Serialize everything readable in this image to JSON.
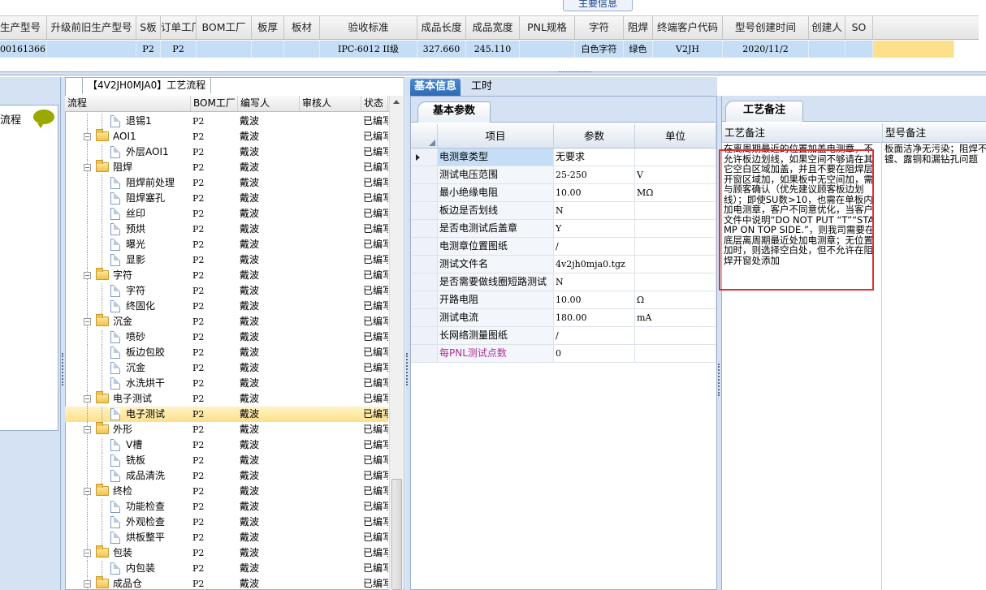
{
  "top": {
    "section_label": "主要信息",
    "columns": [
      "生产型号",
      "升级前旧生产型号",
      "S板",
      "订单工厂",
      "BOM工厂",
      "板厚",
      "板材",
      "验收标准",
      "成品长度",
      "成品宽度",
      "PNL规格",
      "字符",
      "阻焊",
      "终端客户代码",
      "型号创建时间",
      "创建人",
      "SO"
    ],
    "row": [
      "00161366",
      "",
      "P2",
      "P2",
      "",
      "",
      "",
      "IPC-6012 II级",
      "327.660",
      "245.110",
      "",
      "白色字符",
      "绿色",
      "V2JH",
      "2020/11/2",
      "",
      ""
    ]
  },
  "left": {
    "label": "流程"
  },
  "tree": {
    "tab_label": "【4V2JH0MJA0】工艺流程",
    "columns": [
      "流程",
      "BOM工厂",
      "编写人",
      "审核人",
      "状态"
    ],
    "rows": [
      {
        "name": "退锡1",
        "level": 2,
        "type": "doc",
        "bom": "P2",
        "writer": "戴波",
        "reviewer": "",
        "status": "已编写"
      },
      {
        "name": "AOI1",
        "level": 1,
        "type": "folder",
        "bom": "P2",
        "writer": "戴波",
        "reviewer": "",
        "status": "已编写"
      },
      {
        "name": "外层AOI1",
        "level": 2,
        "type": "doc",
        "bom": "P2",
        "writer": "戴波",
        "reviewer": "",
        "status": "已编写"
      },
      {
        "name": "阻焊",
        "level": 1,
        "type": "folder",
        "bom": "P2",
        "writer": "戴波",
        "reviewer": "",
        "status": "已编写"
      },
      {
        "name": "阻焊前处理",
        "level": 2,
        "type": "doc",
        "bom": "P2",
        "writer": "戴波",
        "reviewer": "",
        "status": "已编写"
      },
      {
        "name": "阻焊塞孔",
        "level": 2,
        "type": "doc",
        "bom": "P2",
        "writer": "戴波",
        "reviewer": "",
        "status": "已编写"
      },
      {
        "name": "丝印",
        "level": 2,
        "type": "doc",
        "bom": "P2",
        "writer": "戴波",
        "reviewer": "",
        "status": "已编写"
      },
      {
        "name": "预烘",
        "level": 2,
        "type": "doc",
        "bom": "P2",
        "writer": "戴波",
        "reviewer": "",
        "status": "已编写"
      },
      {
        "name": "曝光",
        "level": 2,
        "type": "doc",
        "bom": "P2",
        "writer": "戴波",
        "reviewer": "",
        "status": "已编写"
      },
      {
        "name": "显影",
        "level": 2,
        "type": "doc",
        "bom": "P2",
        "writer": "戴波",
        "reviewer": "",
        "status": "已编写"
      },
      {
        "name": "字符",
        "level": 1,
        "type": "folder",
        "bom": "P2",
        "writer": "戴波",
        "reviewer": "",
        "status": "已编写"
      },
      {
        "name": "字符",
        "level": 2,
        "type": "doc",
        "bom": "P2",
        "writer": "戴波",
        "reviewer": "",
        "status": "已编写"
      },
      {
        "name": "终固化",
        "level": 2,
        "type": "doc",
        "bom": "P2",
        "writer": "戴波",
        "reviewer": "",
        "status": "已编写"
      },
      {
        "name": "沉金",
        "level": 1,
        "type": "folder",
        "bom": "P2",
        "writer": "戴波",
        "reviewer": "",
        "status": "已编写"
      },
      {
        "name": "喷砂",
        "level": 2,
        "type": "doc",
        "bom": "P2",
        "writer": "戴波",
        "reviewer": "",
        "status": "已编写"
      },
      {
        "name": "板边包胶",
        "level": 2,
        "type": "doc",
        "bom": "P2",
        "writer": "戴波",
        "reviewer": "",
        "status": "已编写"
      },
      {
        "name": "沉金",
        "level": 2,
        "type": "doc",
        "bom": "P2",
        "writer": "戴波",
        "reviewer": "",
        "status": "已编写"
      },
      {
        "name": "水洗烘干",
        "level": 2,
        "type": "doc",
        "bom": "P2",
        "writer": "戴波",
        "reviewer": "",
        "status": "已编写"
      },
      {
        "name": "电子测试",
        "level": 1,
        "type": "folder",
        "bom": "P2",
        "writer": "戴波",
        "reviewer": "",
        "status": "已编写"
      },
      {
        "name": "电子测试",
        "level": 2,
        "type": "doc",
        "bom": "P2",
        "writer": "戴波",
        "reviewer": "",
        "status": "已编写",
        "selected": true
      },
      {
        "name": "外形",
        "level": 1,
        "type": "folder",
        "bom": "P2",
        "writer": "戴波",
        "reviewer": "",
        "status": "已编写"
      },
      {
        "name": "V槽",
        "level": 2,
        "type": "doc",
        "bom": "P2",
        "writer": "戴波",
        "reviewer": "",
        "status": "已编写"
      },
      {
        "name": "铣板",
        "level": 2,
        "type": "doc",
        "bom": "P2",
        "writer": "戴波",
        "reviewer": "",
        "status": "已编写"
      },
      {
        "name": "成品清洗",
        "level": 2,
        "type": "doc",
        "bom": "P2",
        "writer": "戴波",
        "reviewer": "",
        "status": "已编写"
      },
      {
        "name": "终检",
        "level": 1,
        "type": "folder",
        "bom": "P2",
        "writer": "戴波",
        "reviewer": "",
        "status": "已编写"
      },
      {
        "name": "功能检查",
        "level": 2,
        "type": "doc",
        "bom": "P2",
        "writer": "戴波",
        "reviewer": "",
        "status": "已编写"
      },
      {
        "name": "外观检查",
        "level": 2,
        "type": "doc",
        "bom": "P2",
        "writer": "戴波",
        "reviewer": "",
        "status": "已编写"
      },
      {
        "name": "烘板整平",
        "level": 2,
        "type": "doc",
        "bom": "P2",
        "writer": "戴波",
        "reviewer": "",
        "status": "已编写"
      },
      {
        "name": "包装",
        "level": 1,
        "type": "folder",
        "bom": "P2",
        "writer": "戴波",
        "reviewer": "",
        "status": "已编写"
      },
      {
        "name": "内包装",
        "level": 2,
        "type": "doc",
        "bom": "P2",
        "writer": "戴波",
        "reviewer": "",
        "status": "已编写"
      },
      {
        "name": "成品仓",
        "level": 1,
        "type": "folder",
        "bom": "P2",
        "writer": "戴波",
        "reviewer": "",
        "status": "已编写"
      }
    ]
  },
  "mid": {
    "tabs": [
      "基本信息",
      "工时"
    ],
    "subtab": "基本参数",
    "columns": [
      "项目",
      "参数",
      "单位"
    ],
    "rows": [
      {
        "item": "电测章类型",
        "value": "无要求",
        "unit": ""
      },
      {
        "item": "测试电压范围",
        "value": "25-250",
        "unit": "V"
      },
      {
        "item": "最小绝缘电阻",
        "value": "10.00",
        "unit": "MΩ"
      },
      {
        "item": "板边是否划线",
        "value": "N",
        "unit": ""
      },
      {
        "item": "是否电测试后盖章",
        "value": "Y",
        "unit": ""
      },
      {
        "item": "电测章位置图纸",
        "value": "/",
        "unit": ""
      },
      {
        "item": "测试文件名",
        "value": "4v2jh0mja0.tgz",
        "unit": ""
      },
      {
        "item": "是否需要做线圈短路测试",
        "value": "N",
        "unit": ""
      },
      {
        "item": "开路电阻",
        "value": "10.00",
        "unit": "Ω"
      },
      {
        "item": "测试电流",
        "value": "180.00",
        "unit": "mA"
      },
      {
        "item": "长网络测量图纸",
        "value": "/",
        "unit": ""
      },
      {
        "item": "每PNL测试点数",
        "value": "0",
        "unit": ""
      }
    ]
  },
  "right": {
    "tab": "工艺备注",
    "columns": [
      "工艺备注",
      "型号备注"
    ],
    "process_note": "在离周期最近的位置加盖电测章，不允许板边划线，如果空间不够请在其它空白区域加盖，并且不要在阻焊层开窗区域加，如果板中无空间加，需与顾客确认（优先建议顾客板边划线）；即使SU数>10，也需在单板内加电测章，客户不同意优化，当客户文件中说明“DO NOT PUT “T”“STAMP ON TOP SIDE.”，则我司需要在底层离周期最近处加电测章；无位置加时，则选择空白处，但不允许在阻焊开窗处添加",
    "model_note_lines": [
      "板面洁净无污染；阻焊不",
      "镀、露铜和漏钻孔问题"
    ]
  },
  "colors": {
    "accent": "#2f6ab3",
    "selected_row": "#c5def5",
    "highlight_box": "#e03030"
  }
}
